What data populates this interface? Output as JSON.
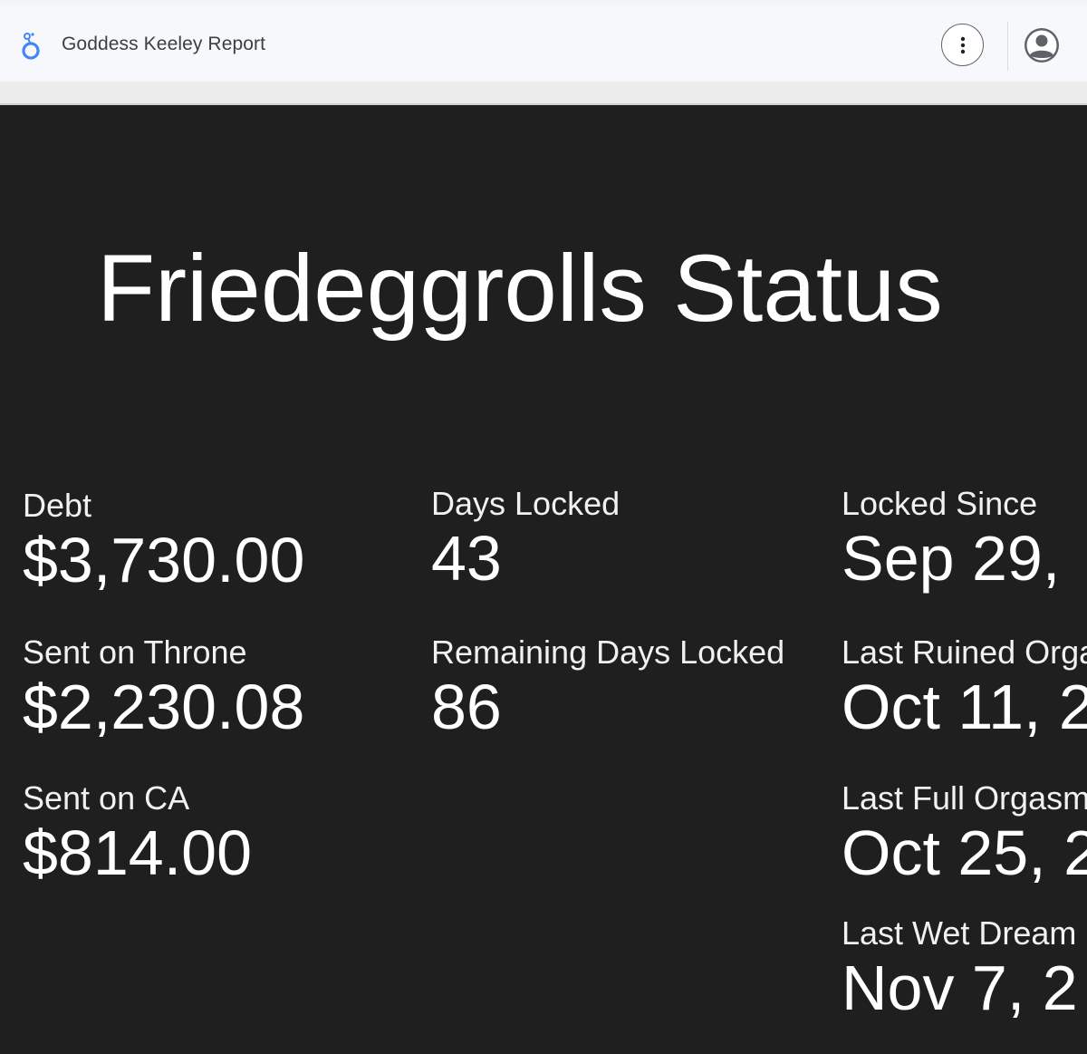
{
  "app": {
    "title": "Goddess Keeley Report",
    "logo_icon": "looker-studio-logo-icon",
    "more_icon": "more-vertical-icon",
    "account_icon": "account-circle-icon",
    "accent_color": "#4285f4"
  },
  "report": {
    "title": "Friedeggrolls Status",
    "background_color": "#1f1f1f",
    "metrics": {
      "debt": {
        "label": "Debt",
        "value": "$3,730.00"
      },
      "sent_on_throne": {
        "label": "Sent on Throne",
        "value": "$2,230.08"
      },
      "sent_on_ca": {
        "label": "Sent on CA",
        "value": "$814.00"
      },
      "days_locked": {
        "label": "Days Locked",
        "value": "43"
      },
      "remaining_days_locked": {
        "label": "Remaining Days Locked",
        "value": "86"
      },
      "locked_since": {
        "label": "Locked Since",
        "value": "Sep 29,"
      },
      "last_ruined_orgasm": {
        "label": "Last Ruined Orga",
        "value": "Oct 11, 2"
      },
      "last_full_orgasm": {
        "label": "Last Full Orgasm",
        "value": "Oct 25, 2"
      },
      "last_wet_dream": {
        "label": "Last Wet Dream",
        "value": "Nov 7, 2"
      }
    }
  }
}
